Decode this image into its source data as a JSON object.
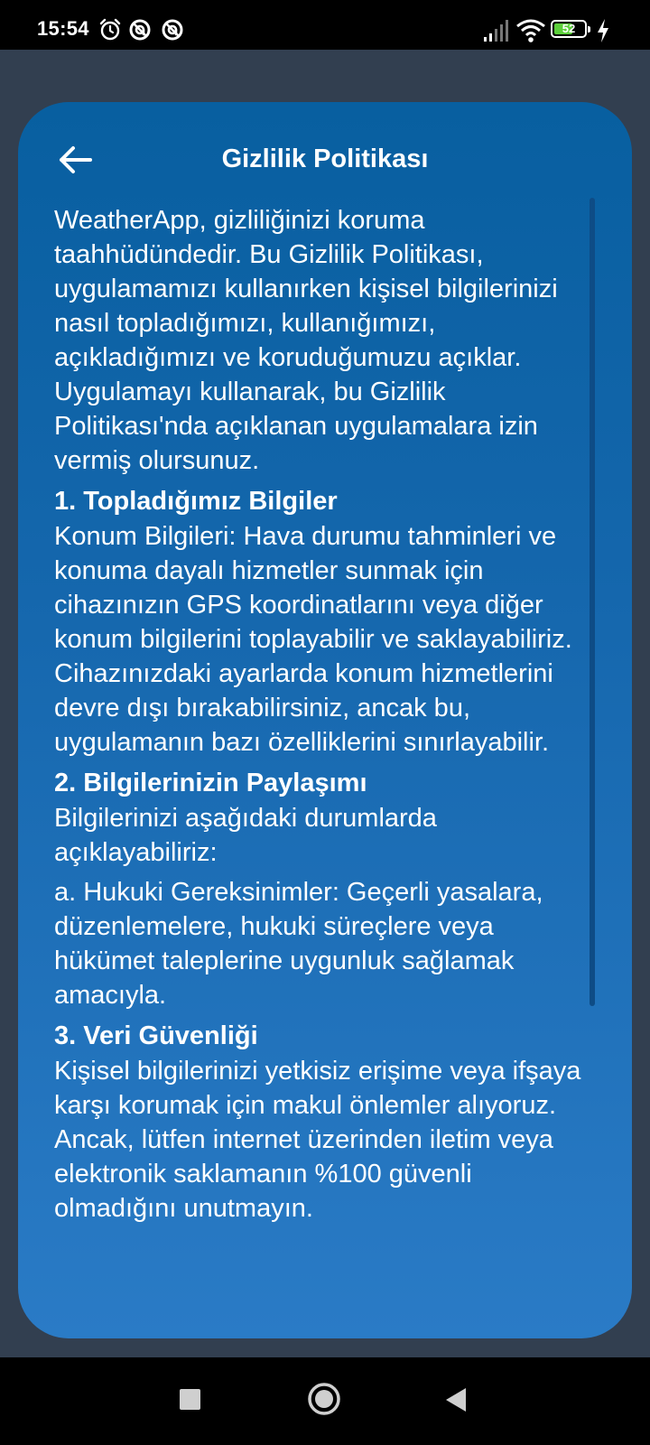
{
  "status_bar": {
    "time": "15:54",
    "battery_level": "52",
    "icons": [
      "alarm-icon",
      "notification-icon",
      "notification-icon",
      "signal-icon",
      "wifi-icon",
      "battery-icon",
      "charging-icon"
    ]
  },
  "header": {
    "title": "Gizlilik Politikası",
    "back_icon": "arrow-left-icon"
  },
  "content": {
    "intro": "WeatherApp, gizliliğinizi koruma taahhüdündedir. Bu Gizlilik Politikası, uygulamamızı kullanırken kişisel bilgilerinizi nasıl topladığımızı, kullanığımızı, açıkladığımızı ve koruduğumuzu açıklar. Uygulamayı kullanarak, bu Gizlilik Politikası'nda açıklanan uygulamalara izin vermiş olursunuz.",
    "section1_title": "1. Topladığımız Bilgiler",
    "section1_body": "Konum Bilgileri: Hava durumu tahminleri ve konuma dayalı hizmetler sunmak için cihazınızın GPS koordinatlarını veya diğer konum bilgilerini toplayabilir ve saklayabiliriz. Cihazınızdaki ayarlarda konum hizmetlerini devre dışı bırakabilirsiniz, ancak bu, uygulamanın bazı özelliklerini sınırlayabilir.",
    "section2_title": "2. Bilgilerinizin Paylaşımı",
    "section2_body": "Bilgilerinizi aşağıdaki durumlarda açıklayabiliriz:",
    "section2_item_a": "a. Hukuki Gereksinimler: Geçerli yasalara, düzenlemelere, hukuki süreçlere veya hükümet taleplerine uygunluk sağlamak amacıyla.",
    "section3_title": "3. Veri Güvenliği",
    "section3_body": "Kişisel bilgilerinizi yetkisiz erişime veya ifşaya karşı korumak için makul önlemler alıyoruz. Ancak, lütfen internet üzerinden iletim veya elektronik saklamanın %100 güvenli olmadığını unutmayın."
  },
  "colors": {
    "background": "#323f50",
    "card_top": "#085fa0",
    "card_bottom": "#2a7bc6",
    "text": "#ffffff"
  },
  "nav_bar": {
    "icons": [
      "recents-square-icon",
      "home-circle-icon",
      "back-triangle-icon"
    ]
  }
}
